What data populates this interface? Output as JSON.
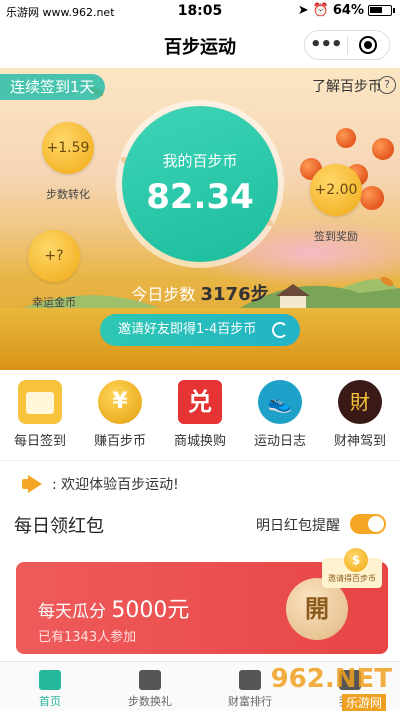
{
  "status_bar": {
    "carrier": "乐游网 www.962.net",
    "time": "18:05",
    "battery": "64%",
    "battery_level": 0.64
  },
  "nav": {
    "title": "百步运动",
    "more_label": "•••"
  },
  "hero": {
    "streak": "连续签到1天",
    "learn": "了解百步币",
    "coins_label": "我的百步币",
    "coins_value": "82.34",
    "bubbles": [
      {
        "value": "+1.59",
        "label": "步数转化"
      },
      {
        "value": "+2.00",
        "label": "签到奖励"
      },
      {
        "value": "+?",
        "label": "幸运金币"
      }
    ],
    "steps_prefix": "今日步数",
    "steps_value": "3176",
    "steps_unit": "步",
    "invite": "邀请好友即得1-4百步币"
  },
  "menu": [
    {
      "label": "每日签到",
      "icon": "calendar-icon",
      "glyph": ""
    },
    {
      "label": "赚百步币",
      "icon": "coin-icon",
      "glyph": "¥"
    },
    {
      "label": "商城换购",
      "icon": "shop-icon",
      "glyph": "兑"
    },
    {
      "label": "运动日志",
      "icon": "shoe-icon",
      "glyph": "👟"
    },
    {
      "label": "财神驾到",
      "icon": "god-icon",
      "glyph": "財"
    }
  ],
  "notice": ": 欢迎体验百步运动!",
  "red_packet": {
    "title": "每日领红包",
    "remind_label": "明日红包提醒",
    "remind_on": true,
    "line1_prefix": "每天瓜分",
    "amount": "5000元",
    "participants": "已有1343人参加",
    "open_label": "開",
    "invite_tag": "邀请得百步币"
  },
  "tabs": [
    {
      "label": "首页",
      "active": true
    },
    {
      "label": "步数换礼",
      "active": false
    },
    {
      "label": "财富排行",
      "active": false
    },
    {
      "label": "我的",
      "active": false
    }
  ],
  "watermark": {
    "main": "962.NET",
    "sub": "乐游网"
  },
  "colors": {
    "accent": "#25b79a",
    "gold": "#f4b429",
    "red": "#e84545"
  }
}
